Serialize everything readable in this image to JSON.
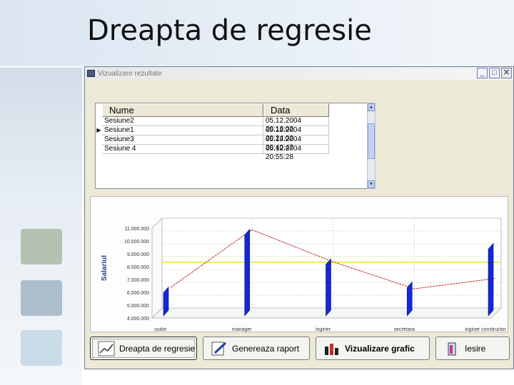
{
  "slide": {
    "title": "Dreapta de regresie"
  },
  "window": {
    "title": "Vizualizare rezultate",
    "controls": {
      "minimize": "_",
      "maximize": "□",
      "close": "✕"
    }
  },
  "grid": {
    "columns": [
      "Nume",
      "Data"
    ],
    "rows": [
      {
        "indicator": "",
        "name": "Sesiune2",
        "date": "05.12.2004 20:16:02"
      },
      {
        "indicator": "▶",
        "name": "Sesiune1",
        "date": "05.12.2004 20:24:02"
      },
      {
        "indicator": "",
        "name": "Sesiune3",
        "date": "05.12.2004 20:40:47"
      },
      {
        "indicator": "",
        "name": "Sesiune 4",
        "date": "05.12.2004 20:55:28"
      }
    ]
  },
  "buttons": {
    "regression": "Dreapta de regresie",
    "report": "Genereaza raport",
    "chart": "Vizualizare grafic",
    "exit": "Iesire"
  },
  "chart_data": {
    "type": "bar",
    "ylabel": "Salariul",
    "yticks": [
      "4.000.000",
      "5.000.000",
      "6.000.000",
      "7.000.000",
      "8.000.000",
      "9.000.000",
      "10.000.000",
      "11.000.000"
    ],
    "ylim": [
      4000000,
      11000000
    ],
    "categories": [
      "sudor",
      "manager",
      "inginer",
      "secretara",
      "inginer constructor"
    ],
    "values": [
      5800000,
      10300000,
      8000000,
      6200000,
      9200000
    ],
    "regression_line": [
      5600000,
      10100000,
      7600000,
      5500000,
      6300000
    ],
    "colors": {
      "bars": "#1428d8",
      "regression": "#c22b2b",
      "mean": "#e6e635"
    },
    "grid": true
  }
}
